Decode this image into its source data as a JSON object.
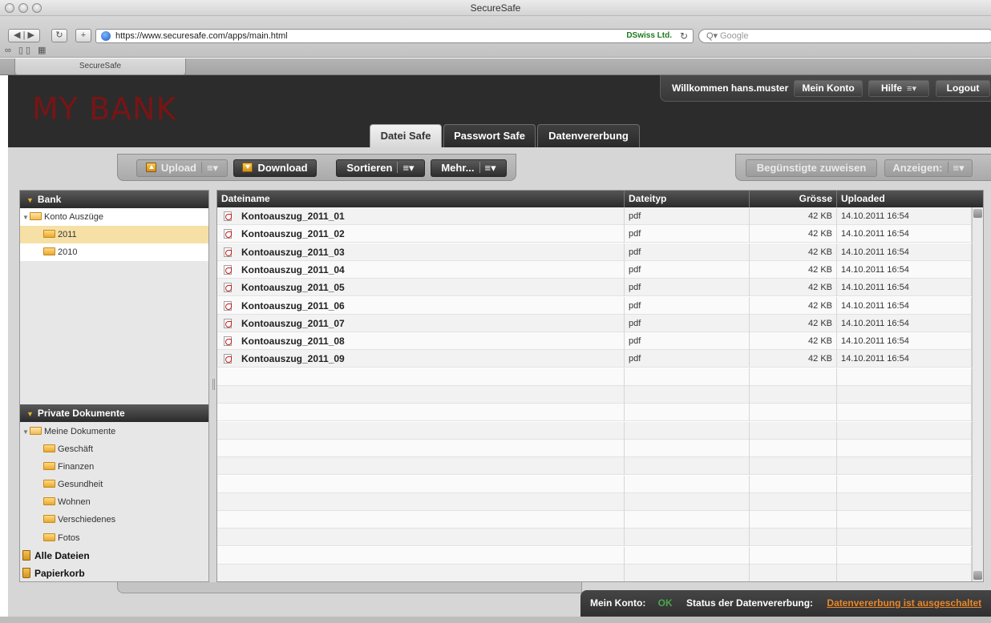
{
  "browser": {
    "window_title": "SecureSafe",
    "url": "https://www.securesafe.com/apps/main.html",
    "cert_owner": "DSwiss Ltd.",
    "search_placeholder": "Google",
    "tab_title": "SecureSafe"
  },
  "header": {
    "brand": "MY BANK",
    "welcome": "Willkommen hans.muster",
    "buttons": {
      "account": "Mein Konto",
      "help": "Hilfe",
      "logout": "Logout"
    },
    "tabs": [
      {
        "label": "Datei Safe",
        "active": true
      },
      {
        "label": "Passwort Safe",
        "active": false
      },
      {
        "label": "Datenvererbung",
        "active": false
      }
    ]
  },
  "actions": {
    "upload": "Upload",
    "download": "Download",
    "sort": "Sortieren",
    "more": "Mehr...",
    "assign": "Begünstigte zuweisen",
    "view": "Anzeigen:"
  },
  "sidebar": {
    "bank_section": "Bank",
    "bank_items": [
      {
        "label": "Konto Auszüge",
        "level": 0,
        "expanded": true
      },
      {
        "label": "2011",
        "level": 1,
        "selected": true
      },
      {
        "label": "2010",
        "level": 1
      }
    ],
    "private_section": "Private Dokumente",
    "private_items": [
      {
        "label": "Meine Dokumente",
        "level": 0,
        "expanded": true
      },
      {
        "label": "Geschäft",
        "level": 1
      },
      {
        "label": "Finanzen",
        "level": 1
      },
      {
        "label": "Gesundheit",
        "level": 1
      },
      {
        "label": "Wohnen",
        "level": 1
      },
      {
        "label": "Verschiedenes",
        "level": 1
      },
      {
        "label": "Fotos",
        "level": 1
      }
    ],
    "all_files": "Alle Dateien",
    "trash": "Papierkorb"
  },
  "table": {
    "columns": [
      "Dateiname",
      "Dateityp",
      "Grösse",
      "Uploaded"
    ],
    "rows": [
      {
        "name": "Kontoauszug_2011_01",
        "type": "pdf",
        "size": "42 KB",
        "uploaded": "14.10.2011 16:54"
      },
      {
        "name": "Kontoauszug_2011_02",
        "type": "pdf",
        "size": "42 KB",
        "uploaded": "14.10.2011 16:54"
      },
      {
        "name": "Kontoauszug_2011_03",
        "type": "pdf",
        "size": "42 KB",
        "uploaded": "14.10.2011 16:54"
      },
      {
        "name": "Kontoauszug_2011_04",
        "type": "pdf",
        "size": "42 KB",
        "uploaded": "14.10.2011 16:54"
      },
      {
        "name": "Kontoauszug_2011_05",
        "type": "pdf",
        "size": "42 KB",
        "uploaded": "14.10.2011 16:54"
      },
      {
        "name": "Kontoauszug_2011_06",
        "type": "pdf",
        "size": "42 KB",
        "uploaded": "14.10.2011 16:54"
      },
      {
        "name": "Kontoauszug_2011_07",
        "type": "pdf",
        "size": "42 KB",
        "uploaded": "14.10.2011 16:54"
      },
      {
        "name": "Kontoauszug_2011_08",
        "type": "pdf",
        "size": "42 KB",
        "uploaded": "14.10.2011 16:54"
      },
      {
        "name": "Kontoauszug_2011_09",
        "type": "pdf",
        "size": "42 KB",
        "uploaded": "14.10.2011 16:54"
      }
    ]
  },
  "status": {
    "account_label": "Mein Konto:",
    "account_value": "OK",
    "inheritance_label": "Status der Datenvererbung:",
    "inheritance_value": "Datenvererbung ist ausgeschaltet"
  },
  "colors": {
    "brand": "#7a1414",
    "header_bg": "#2c2c2c",
    "selected_folder": "#f6e0a6",
    "status_ok": "#4aa84a",
    "status_link": "#e9872a"
  }
}
